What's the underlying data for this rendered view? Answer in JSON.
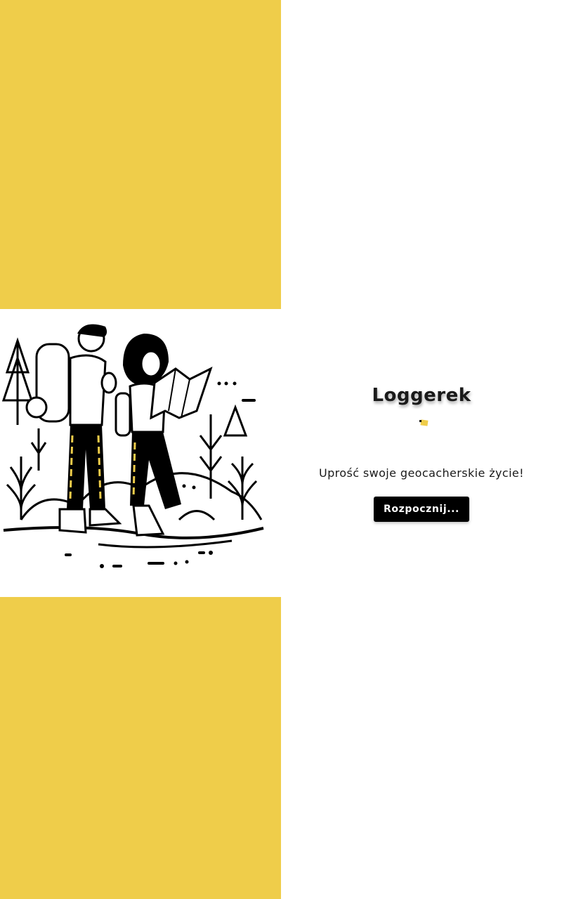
{
  "app": {
    "title": "Loggerek",
    "tagline": "Uprość swoje geocacherskie życie!",
    "start_label": "Rozpocznij...",
    "accent_color": "#efcd4a"
  },
  "icons": {
    "logo": "geocache-box-icon",
    "illustration": "hikers-with-map-illustration"
  }
}
